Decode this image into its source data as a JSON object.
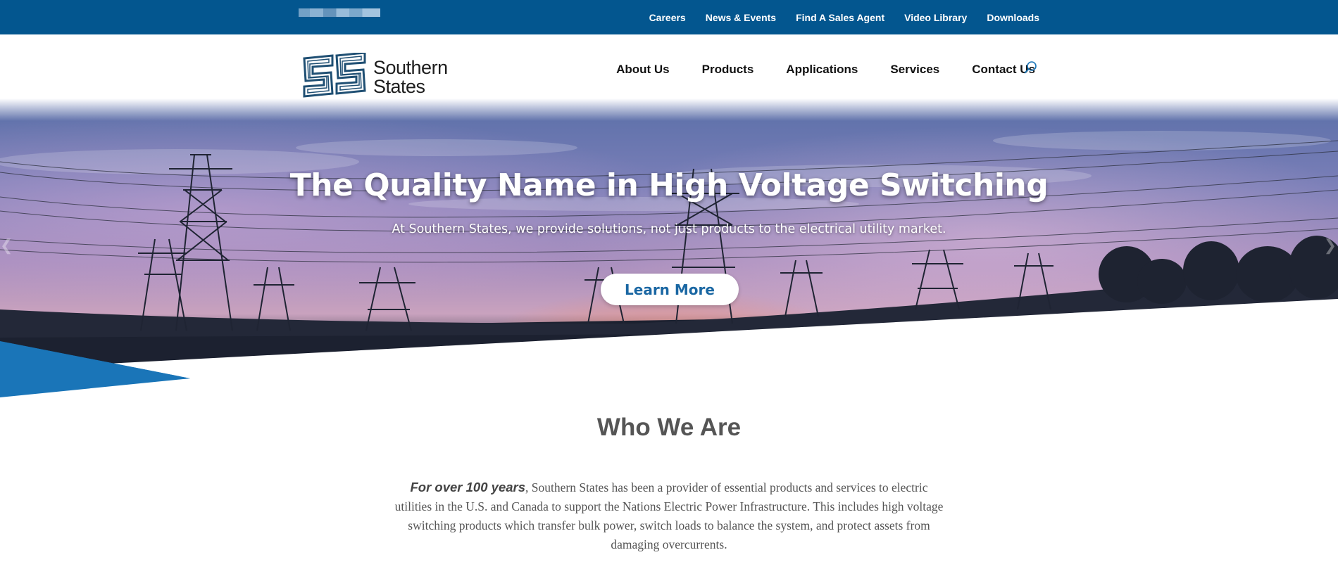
{
  "topbar": {
    "links": [
      "Careers",
      "News & Events",
      "Find A Sales Agent",
      "Video Library",
      "Downloads"
    ],
    "background": "#03568f"
  },
  "header": {
    "logo_line1": "Southern",
    "logo_line2": "States",
    "nav": [
      "About Us",
      "Products",
      "Applications",
      "Services",
      "Contact Us"
    ],
    "search_icon": "search-icon"
  },
  "hero": {
    "title": "The Quality Name in High Voltage Switching",
    "subtitle": "At Southern States, we provide solutions, not just products to the electrical utility market.",
    "button": "Learn More",
    "accent": "#1a75b8"
  },
  "about": {
    "title": "Who We Are",
    "lead": "For over 100 years",
    "body": ", Southern States has been a provider of essential products and services to electric utilities in the U.S. and Canada to support the Nations Electric Power Infrastructure. This includes high voltage switching products which transfer bulk power, switch loads to balance the system, and protect assets from damaging overcurrents."
  },
  "colors": {
    "primary": "#03568f",
    "button_text": "#1a67a3",
    "heading_gray": "#555555"
  }
}
